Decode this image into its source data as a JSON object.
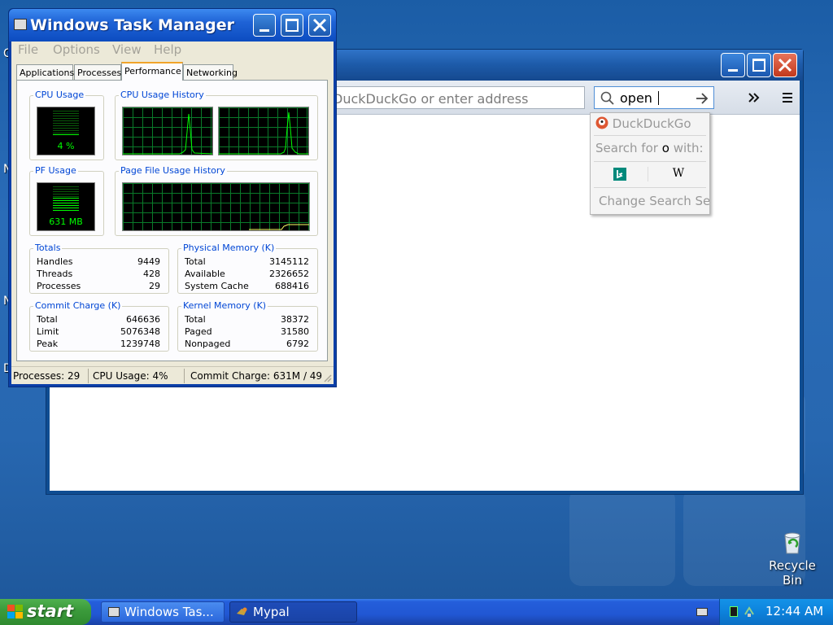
{
  "desktop": {
    "left_letters": [
      "C",
      "N",
      "N",
      "D"
    ],
    "recycle_bin_label": "Recycle Bin"
  },
  "browser": {
    "address_placeholder": "DuckDuckGo or enter address",
    "search_query": "open",
    "search_popup": {
      "engine_header": "DuckDuckGo",
      "search_for_prefix": "Search for",
      "search_for_query": "o",
      "search_for_suffix": "with:",
      "engines": [
        "bing",
        "W"
      ],
      "change_settings": "Change Search Se"
    }
  },
  "taskmanager": {
    "title": "Windows Task Manager",
    "menu": [
      "File",
      "Options",
      "View",
      "Help"
    ],
    "tabs": [
      "Applications",
      "Processes",
      "Performance",
      "Networking"
    ],
    "active_tab": "Performance",
    "cpu_usage": {
      "label": "CPU Usage",
      "value": "4 %",
      "level": 0.04
    },
    "cpu_history": {
      "label": "CPU Usage History"
    },
    "pf_usage": {
      "label": "PF Usage",
      "value": "631 MB"
    },
    "pf_history": {
      "label": "Page File Usage History"
    },
    "totals": {
      "label": "Totals",
      "rows": [
        {
          "k": "Handles",
          "v": "9449"
        },
        {
          "k": "Threads",
          "v": "428"
        },
        {
          "k": "Processes",
          "v": "29"
        }
      ]
    },
    "physical_memory": {
      "label": "Physical Memory (K)",
      "rows": [
        {
          "k": "Total",
          "v": "3145112"
        },
        {
          "k": "Available",
          "v": "2326652"
        },
        {
          "k": "System Cache",
          "v": "688416"
        }
      ]
    },
    "commit_charge": {
      "label": "Commit Charge (K)",
      "rows": [
        {
          "k": "Total",
          "v": "646636"
        },
        {
          "k": "Limit",
          "v": "5076348"
        },
        {
          "k": "Peak",
          "v": "1239748"
        }
      ]
    },
    "kernel_memory": {
      "label": "Kernel Memory (K)",
      "rows": [
        {
          "k": "Total",
          "v": "38372"
        },
        {
          "k": "Paged",
          "v": "31580"
        },
        {
          "k": "Nonpaged",
          "v": "6792"
        }
      ]
    },
    "status": {
      "processes": "Processes: 29",
      "cpu": "CPU Usage: 4%",
      "commit": "Commit Charge: 631M / 49"
    }
  },
  "taskbar": {
    "start_label": "start",
    "tasks": [
      "Windows Tas...",
      "Mypal"
    ],
    "clock": "12:44 AM"
  },
  "colors": {
    "xp_blue": "#245edb",
    "start_green": "#3c9c3c",
    "graph_green": "#00ff00",
    "group_label_blue": "#0046d5"
  }
}
